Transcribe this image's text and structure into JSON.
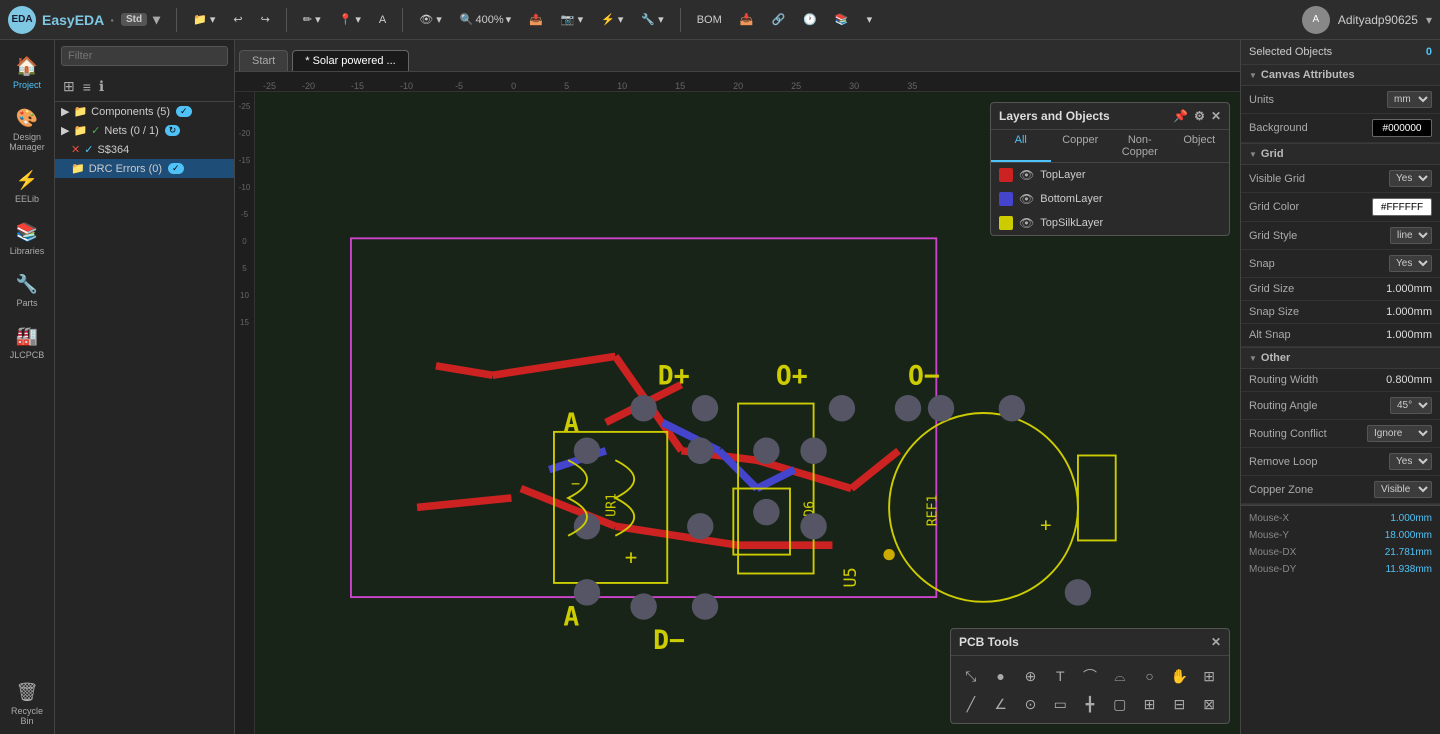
{
  "app": {
    "name": "EasyEDA",
    "edition": "Std",
    "logo_text": "EDA"
  },
  "toolbar": {
    "file_btn": "📁",
    "undo_label": "↩",
    "redo_label": "↪",
    "draw_label": "✏",
    "marker_label": "📍",
    "view_label": "👁",
    "zoom_label": "400%",
    "export_label": "📤",
    "camera_label": "📷",
    "connect_label": "🔗",
    "tools_label": "🔧",
    "bom_label": "BOM",
    "import_label": "📥",
    "share_label": "🔗",
    "history_label": "🕐",
    "layers_label": "📚",
    "more_label": "▾",
    "username": "Adityadp90625"
  },
  "tabs": [
    {
      "label": "Start",
      "active": false
    },
    {
      "label": "* Solar powered ...",
      "active": true
    }
  ],
  "sidebar": {
    "items": [
      {
        "id": "project",
        "icon": "🏠",
        "label": "Project"
      },
      {
        "id": "design",
        "icon": "🎨",
        "label": "Design\nManager"
      },
      {
        "id": "eelib",
        "icon": "⚡",
        "label": "EELib"
      },
      {
        "id": "libraries",
        "icon": "📚",
        "label": "Libraries"
      },
      {
        "id": "parts",
        "icon": "🔧",
        "label": "Parts"
      },
      {
        "id": "jlcpcb",
        "icon": "🏭",
        "label": "JLCPCB"
      },
      {
        "id": "recycle",
        "icon": "🗑",
        "label": "Recycle\nBin"
      }
    ]
  },
  "file_panel": {
    "filter_placeholder": "Filter",
    "items": [
      {
        "level": 0,
        "icon": "📁",
        "label": "Components (5)",
        "has_badge": false,
        "type": "folder"
      },
      {
        "level": 0,
        "icon": "📁",
        "label": "Nets (0 / 1)",
        "has_badge": false,
        "type": "folder"
      },
      {
        "level": 1,
        "icon": "❌",
        "label": "S$364",
        "has_badge": false,
        "type": "net"
      },
      {
        "level": 1,
        "icon": "📁",
        "label": "DRC Errors (0)",
        "has_badge": false,
        "type": "folder",
        "active": true
      }
    ]
  },
  "layers_panel": {
    "title": "Layers and Objects",
    "tabs": [
      "All",
      "Copper",
      "Non-Copper",
      "Object"
    ],
    "active_tab": "All",
    "layers": [
      {
        "name": "TopLayer",
        "color": "#cc0000",
        "visible": true
      },
      {
        "name": "BottomLayer",
        "color": "#0000cc",
        "visible": true
      },
      {
        "name": "TopSilkLayer",
        "color": "#cccc00",
        "visible": true
      }
    ]
  },
  "pcb_tools": {
    "title": "PCB Tools",
    "tools": [
      "⤡",
      "⬤",
      "⊕",
      "T",
      "⌒",
      "⌓",
      "○",
      "✋",
      "⊞",
      "☒",
      "╱",
      "∠",
      "⊙",
      "▭",
      "╋",
      "▢",
      "⊞",
      "⊟",
      "⊠"
    ]
  },
  "right_panel": {
    "selected_objects": {
      "label": "Selected Objects",
      "count": "0"
    },
    "canvas_attributes": {
      "label": "Canvas Attributes"
    },
    "units": {
      "label": "Units",
      "value": "mm"
    },
    "background": {
      "label": "Background",
      "value": "#000000"
    },
    "grid_section": {
      "label": "Grid"
    },
    "visible_grid": {
      "label": "Visible Grid",
      "value": "Yes"
    },
    "grid_color": {
      "label": "Grid Color",
      "value": "#FFFFFF"
    },
    "grid_style": {
      "label": "Grid Style",
      "value": "line"
    },
    "snap": {
      "label": "Snap",
      "value": "Yes"
    },
    "grid_size": {
      "label": "Grid Size",
      "value": "1.000mm"
    },
    "snap_size": {
      "label": "Snap Size",
      "value": "1.000mm"
    },
    "alt_snap": {
      "label": "Alt Snap",
      "value": "1.000mm"
    },
    "other_section": {
      "label": "Other"
    },
    "routing_width": {
      "label": "Routing Width",
      "value": "0.800mm"
    },
    "routing_angle": {
      "label": "Routing Angle",
      "value": "45°"
    },
    "routing_conflict": {
      "label": "Routing Conflict",
      "value": "Ignore"
    },
    "remove_loop": {
      "label": "Remove Loop",
      "value": "Yes"
    },
    "copper_zone": {
      "label": "Copper Zone",
      "value": "Visible"
    },
    "mouse": {
      "x_label": "Mouse-X",
      "x_value": "1.000mm",
      "y_label": "Mouse-Y",
      "y_value": "18.000mm",
      "dx_label": "Mouse-DX",
      "dx_value": "21.781mm",
      "dy_label": "Mouse-DY",
      "dy_value": "11.938mm"
    }
  },
  "ruler": {
    "marks": [
      "-25",
      "-20",
      "-15",
      "-10",
      "-5",
      "0",
      "",
      "5",
      "",
      "10",
      "",
      "15",
      "",
      "20",
      "",
      "25",
      "",
      "30",
      "",
      "35"
    ]
  }
}
